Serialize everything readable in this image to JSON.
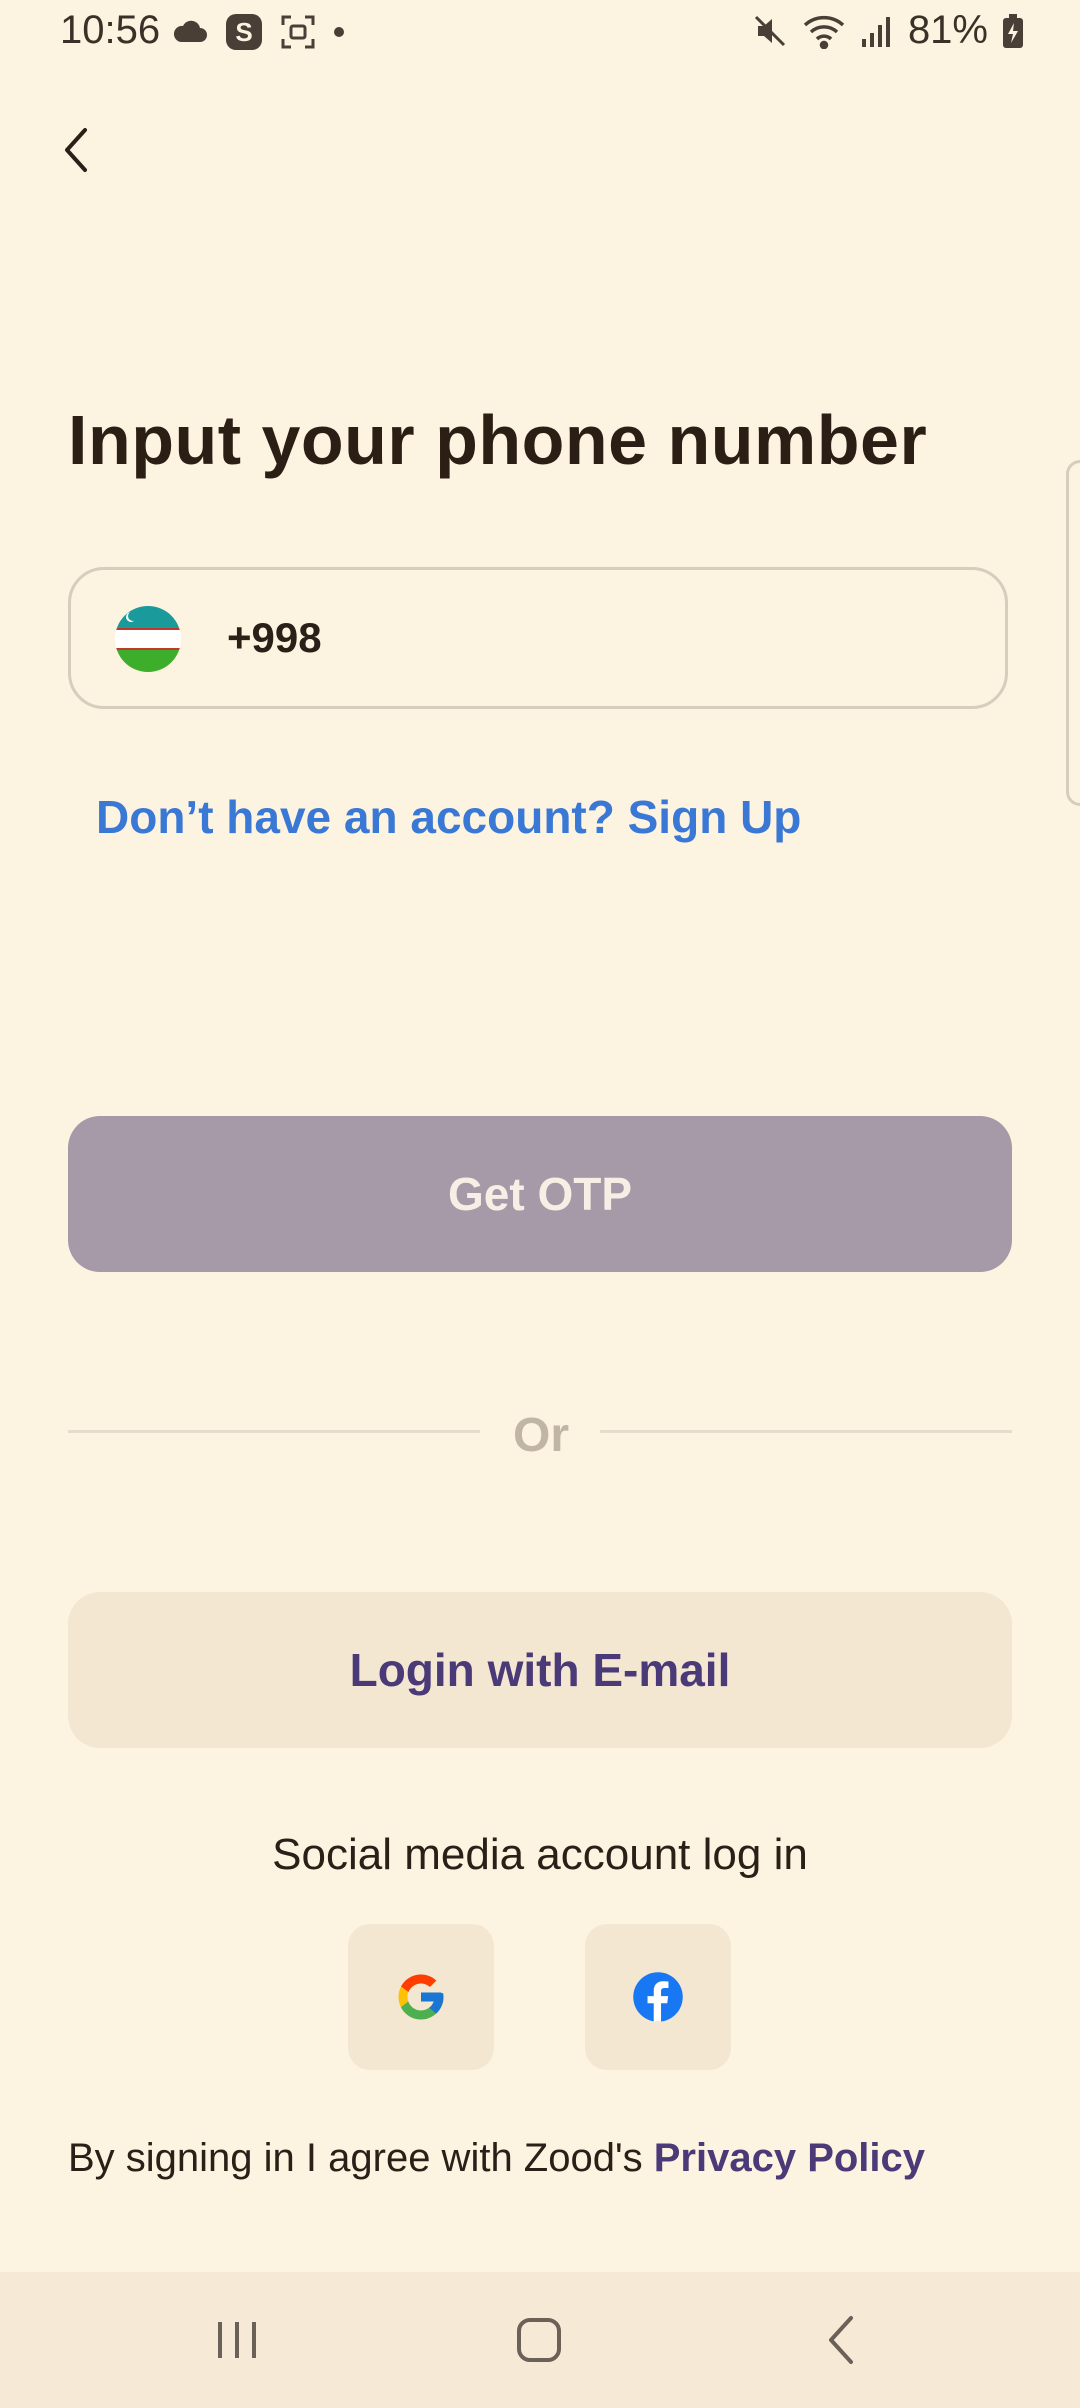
{
  "status_bar": {
    "time": "10:56",
    "s_badge": "S",
    "battery_pct": "81%",
    "icons": [
      "cloud-icon",
      "s-badge-icon",
      "screen-capture-icon",
      "dot-icon",
      "mute-icon",
      "wifi-icon",
      "signal-icon",
      "battery-charging-icon"
    ]
  },
  "header": {
    "back_icon": "chevron-left-icon"
  },
  "main": {
    "title": "Input your phone number",
    "phone": {
      "country_flag": "uzbekistan-flag-icon",
      "prefix": "+998"
    },
    "signup_link": "Don’t have an account? Sign Up",
    "otp_button": "Get OTP",
    "divider_text": "Or",
    "email_button": "Login with E-mail",
    "social_title": "Social media account log in",
    "social": [
      {
        "name": "google-icon"
      },
      {
        "name": "facebook-icon"
      }
    ],
    "agree_text": "By signing in I agree with Zood's ",
    "privacy_link": "Privacy Policy"
  },
  "nav": {
    "items": [
      "recents-icon",
      "home-icon",
      "back-icon"
    ]
  },
  "colors": {
    "background": "#fdf3e1",
    "link_blue": "#3a78d6",
    "otp_disabled": "#a69aa8",
    "brand_purple": "#4a3a78",
    "email_bg": "#f4e7d2"
  }
}
